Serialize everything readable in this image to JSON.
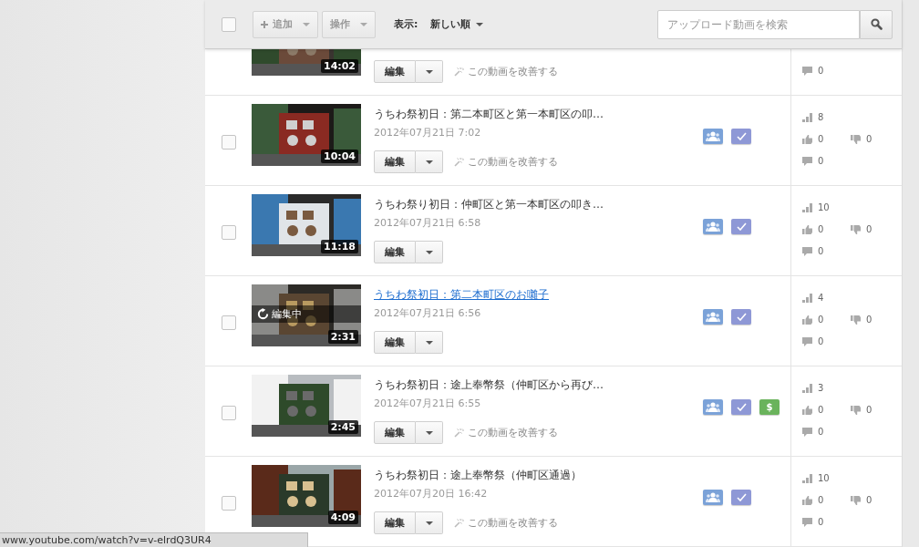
{
  "toolbar": {
    "select_all_checked": false,
    "add_button": "追加",
    "actions_button": "操作",
    "sort_label": "表示:",
    "sort_value": "新しい順",
    "search": {
      "placeholder": "アップロード動画を検索"
    }
  },
  "videos": [
    {
      "duration": "14:02",
      "edit_button": "編集",
      "improve_link": "この動画を改善する",
      "stats": {
        "comments": "0"
      }
    },
    {
      "checked": false,
      "title": "うちわ祭初日：第二本町区と第一本町区の叩…",
      "hovered": false,
      "date": "2012年07月21日 7:02",
      "duration": "10:04",
      "edit_button": "編集",
      "improve_link": "この動画を改善する",
      "badges": [
        {
          "kind": "public"
        },
        {
          "kind": "checked"
        }
      ],
      "stats": {
        "views": "8",
        "likes": "0",
        "dislikes": "0",
        "comments": "0"
      }
    },
    {
      "checked": false,
      "title": "うちわ祭り初日：仲町区と第一本町区の叩き…",
      "hovered": false,
      "date": "2012年07月21日 6:58",
      "duration": "11:18",
      "edit_button": "編集",
      "badges": [
        {
          "kind": "public"
        },
        {
          "kind": "checked"
        }
      ],
      "stats": {
        "views": "10",
        "likes": "0",
        "dislikes": "0",
        "comments": "0"
      }
    },
    {
      "checked": false,
      "title": "うちわ祭初日：第二本町区のお囃子",
      "hovered": true,
      "date": "2012年07月21日 6:56",
      "duration": "2:31",
      "processing_label": "編集中",
      "edit_button": "編集",
      "badges": [
        {
          "kind": "public"
        },
        {
          "kind": "checked"
        }
      ],
      "stats": {
        "views": "4",
        "likes": "0",
        "dislikes": "0",
        "comments": "0"
      }
    },
    {
      "checked": false,
      "title": "うちわ祭初日：途上奉幣祭（仲町区から再び…",
      "hovered": false,
      "date": "2012年07月21日 6:55",
      "duration": "2:45",
      "edit_button": "編集",
      "improve_link": "この動画を改善する",
      "badges": [
        {
          "kind": "public"
        },
        {
          "kind": "checked"
        },
        {
          "kind": "monetized",
          "label": "$"
        }
      ],
      "stats": {
        "views": "3",
        "likes": "0",
        "dislikes": "0",
        "comments": "0"
      }
    },
    {
      "checked": false,
      "title": "うちわ祭初日：途上奉幣祭（仲町区通過）",
      "hovered": false,
      "date": "2012年07月20日 16:42",
      "duration": "4:09",
      "edit_button": "編集",
      "improve_link": "この動画を改善する",
      "badges": [
        {
          "kind": "public"
        },
        {
          "kind": "checked"
        }
      ],
      "stats": {
        "views": "10",
        "likes": "0",
        "dislikes": "0",
        "comments": "0"
      }
    }
  ],
  "status_bar": {
    "url": "www.youtube.com/watch?v=v-elrdQ3UR4"
  }
}
